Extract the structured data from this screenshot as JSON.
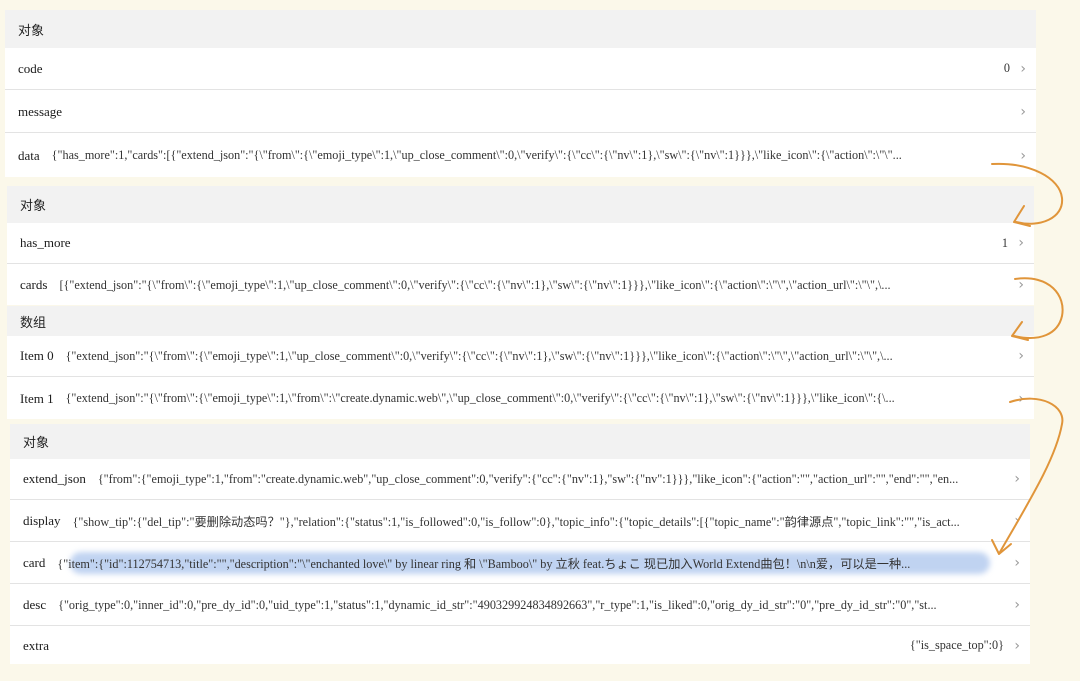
{
  "panel1": {
    "header": "对象",
    "rows": [
      {
        "key": "code",
        "value": "0"
      },
      {
        "key": "message",
        "value": ""
      },
      {
        "key": "data",
        "value": "{\"has_more\":1,\"cards\":[{\"extend_json\":\"{\\\"from\\\":{\\\"emoji_type\\\":1,\\\"up_close_comment\\\":0,\\\"verify\\\":{\\\"cc\\\":{\\\"nv\\\":1},\\\"sw\\\":{\\\"nv\\\":1}}},\\\"like_icon\\\":{\\\"action\\\":\\\"\\\"..."
      }
    ]
  },
  "panel2": {
    "header": "对象",
    "rows": [
      {
        "key": "has_more",
        "value": "1"
      },
      {
        "key": "cards",
        "value": "[{\"extend_json\":\"{\\\"from\\\":{\\\"emoji_type\\\":1,\\\"up_close_comment\\\":0,\\\"verify\\\":{\\\"cc\\\":{\\\"nv\\\":1},\\\"sw\\\":{\\\"nv\\\":1}}},\\\"like_icon\\\":{\\\"action\\\":\\\"\\\",\\\"action_url\\\":\\\"\\\",\\..."
      }
    ]
  },
  "panel3": {
    "header": "数组",
    "rows": [
      {
        "key": "Item 0",
        "value": "{\"extend_json\":\"{\\\"from\\\":{\\\"emoji_type\\\":1,\\\"up_close_comment\\\":0,\\\"verify\\\":{\\\"cc\\\":{\\\"nv\\\":1},\\\"sw\\\":{\\\"nv\\\":1}}},\\\"like_icon\\\":{\\\"action\\\":\\\"\\\",\\\"action_url\\\":\\\"\\\",\\..."
      },
      {
        "key": "Item 1",
        "value": "{\"extend_json\":\"{\\\"from\\\":{\\\"emoji_type\\\":1,\\\"from\\\":\\\"create.dynamic.web\\\",\\\"up_close_comment\\\":0,\\\"verify\\\":{\\\"cc\\\":{\\\"nv\\\":1},\\\"sw\\\":{\\\"nv\\\":1}}},\\\"like_icon\\\":{\\..."
      }
    ]
  },
  "panel4": {
    "header": "对象",
    "rows": [
      {
        "key": "extend_json",
        "value": "{\"from\":{\"emoji_type\":1,\"from\":\"create.dynamic.web\",\"up_close_comment\":0,\"verify\":{\"cc\":{\"nv\":1},\"sw\":{\"nv\":1}}},\"like_icon\":{\"action\":\"\",\"action_url\":\"\",\"end\":\"\",\"en..."
      },
      {
        "key": "display",
        "value": "{\"show_tip\":{\"del_tip\":\"要删除动态吗？\"},\"relation\":{\"status\":1,\"is_followed\":0,\"is_follow\":0},\"topic_info\":{\"topic_details\":[{\"topic_name\":\"韵律源点\",\"topic_link\":\"\",\"is_act..."
      },
      {
        "key": "card",
        "value": "{\"item\":{\"id\":112754713,\"title\":\"\",\"description\":\"\\\"enchanted love\\\" by linear ring 和 \\\"Bamboo\\\" by 立秋 feat.ちょこ 现已加入World Extend曲包！\\n\\n爱，可以是一种..."
      },
      {
        "key": "desc",
        "value": "{\"orig_type\":0,\"inner_id\":0,\"pre_dy_id\":0,\"uid_type\":1,\"status\":1,\"dynamic_id_str\":\"490329924834892663\",\"r_type\":1,\"is_liked\":0,\"orig_dy_id_str\":\"0\",\"pre_dy_id_str\":\"0\",\"st..."
      },
      {
        "key": "extra",
        "value": "{\"is_space_top\":0}"
      }
    ]
  },
  "chevron": "›",
  "colors": {
    "background": "#fbf8ea",
    "header": "#f2f2f2",
    "arrow": "#e0953a",
    "highlight": "#8cafe6"
  }
}
